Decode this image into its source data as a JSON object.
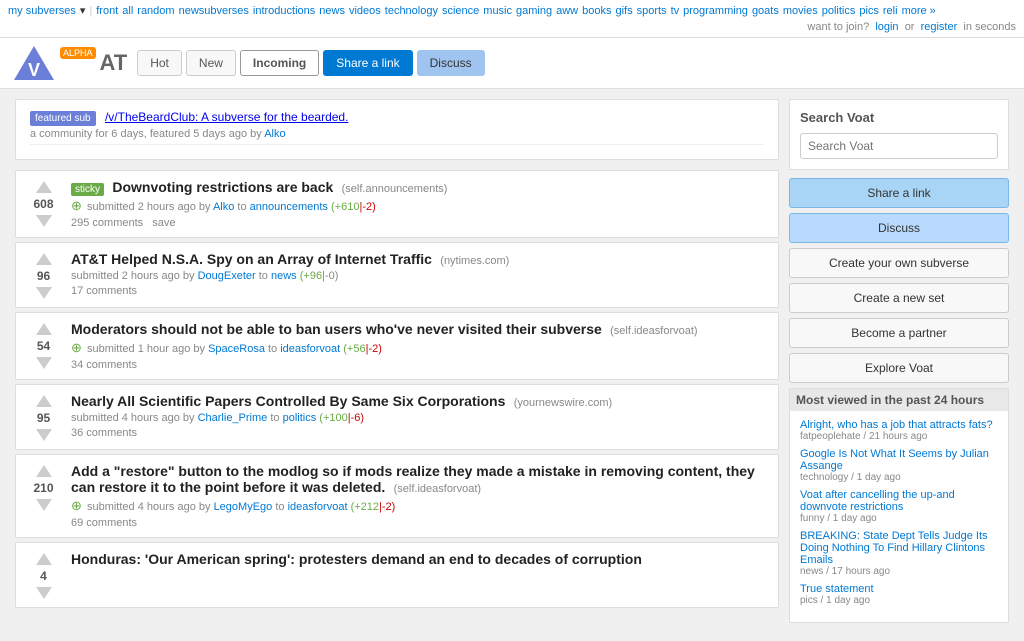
{
  "topnav": {
    "mysubverses": "my subverses",
    "front": "front",
    "all": "all",
    "random": "random",
    "newsubverses": "newsubverses",
    "introductions": "introductions",
    "news": "news",
    "videos": "videos",
    "technology": "technology",
    "science": "science",
    "music": "music",
    "gaming": "gaming",
    "aww": "aww",
    "books": "books",
    "gifs": "gifs",
    "sports": "sports",
    "tv": "tv",
    "programming": "programming",
    "goats": "goats",
    "movies": "movies",
    "politics": "politics",
    "pics": "pics",
    "reli": "reli",
    "more": "more »",
    "join_text": "want to join?",
    "login": "login",
    "or": "or",
    "register": "register",
    "in_seconds": "in seconds"
  },
  "header": {
    "tabs": {
      "hot": "Hot",
      "new": "New",
      "incoming": "Incoming",
      "share_link": "Share a link",
      "discuss": "Discuss"
    },
    "logo_alpha": "ALPHA"
  },
  "featured": {
    "label": "featured sub",
    "title": "/v/TheBeardClub: A subverse for the bearded.",
    "meta": "a community for 6 days, featured 5 days ago by",
    "author": "Alko",
    "divider": true
  },
  "posts": [
    {
      "id": "post1",
      "vote_count": "608",
      "sticky": true,
      "title": "Downvoting restrictions are back",
      "domain": "(self.announcements)",
      "plus": true,
      "meta_pre": "submitted 2 hours ago by",
      "author": "Alko",
      "to": "to",
      "subverse": "announcements",
      "score": "+610",
      "score_neg": "-2",
      "comments": "295 comments",
      "save": "save"
    },
    {
      "id": "post2",
      "vote_count": "96",
      "sticky": false,
      "title": "AT&T Helped N.S.A. Spy on an Array of Internet Traffic",
      "domain": "(nytimes.com)",
      "plus": false,
      "meta_pre": "submitted 2 hours ago by",
      "author": "DougExeter",
      "to": "to",
      "subverse": "news",
      "score": "+96",
      "score_neg": "-0",
      "comments": "17 comments",
      "save": ""
    },
    {
      "id": "post3",
      "vote_count": "54",
      "sticky": false,
      "title": "Moderators should not be able to ban users who've never visited their subverse",
      "domain": "(self.ideasforvoat)",
      "plus": true,
      "meta_pre": "submitted 1 hour ago by",
      "author": "SpaceRosa",
      "to": "to",
      "subverse": "ideasforvoat",
      "score": "+56",
      "score_neg": "-2",
      "comments": "34 comments",
      "save": ""
    },
    {
      "id": "post4",
      "vote_count": "95",
      "sticky": false,
      "title": "Nearly All Scientific Papers Controlled By Same Six Corporations",
      "domain": "(yournewswire.com)",
      "plus": false,
      "meta_pre": "submitted 4 hours ago by",
      "author": "Charlie_Prime",
      "to": "to",
      "subverse": "politics",
      "score": "+100",
      "score_neg": "-6",
      "comments": "36 comments",
      "save": ""
    },
    {
      "id": "post5",
      "vote_count": "210",
      "sticky": false,
      "title": "Add a \"restore\" button to the modlog so if mods realize they made a mistake in removing content, they can restore it to the point before it was deleted.",
      "domain": "(self.ideasforvoat)",
      "plus": true,
      "meta_pre": "submitted 4 hours ago by",
      "author": "LegoMyEgo",
      "to": "to",
      "subverse": "ideasforvoat",
      "score": "+212",
      "score_neg": "-2",
      "comments": "69 comments",
      "save": ""
    },
    {
      "id": "post6",
      "vote_count": "4",
      "sticky": false,
      "title": "Honduras: 'Our American spring': protesters demand an end to decades of corruption",
      "domain": "",
      "plus": false,
      "meta_pre": "",
      "author": "",
      "to": "",
      "subverse": "",
      "score": "",
      "score_neg": "",
      "comments": "",
      "save": ""
    }
  ],
  "sidebar": {
    "search_title": "Search Voat",
    "search_placeholder": "Search Voat",
    "share_link": "Share a link",
    "discuss": "Discuss",
    "create_subverse": "Create your own subverse",
    "create_set": "Create a new set",
    "become_partner": "Become a partner",
    "explore": "Explore Voat",
    "most_viewed_title": "Most viewed in the past 24 hours",
    "most_viewed_items": [
      {
        "title": "Alright, who has a job that attracts fats?",
        "meta": "fatpeoplehate / 21 hours ago"
      },
      {
        "title": "Google Is Not What It Seems  by Julian Assange",
        "meta": "technology / 1 day ago"
      },
      {
        "title": "Voat after cancelling the up-and downvote restrictions",
        "meta": "funny / 1 day ago"
      },
      {
        "title": "BREAKING: State Dept Tells Judge Its Doing Nothing To Find Hillary Clintons Emails",
        "meta": "news / 17 hours ago"
      },
      {
        "title": "True statement",
        "meta": "pics / 1 day ago"
      }
    ]
  }
}
